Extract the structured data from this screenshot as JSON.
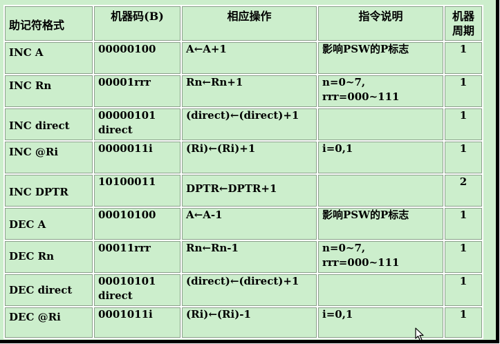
{
  "table": {
    "headers": [
      "助记符格式",
      "机器码(B)",
      "相应操作",
      "指令说明",
      "机器\n周期"
    ],
    "rows": [
      {
        "fmt": "INC A",
        "code": "00000100",
        "op": "A←A+1",
        "desc": "影响PSW的P标志",
        "cycles": "1"
      },
      {
        "fmt": "INC Rn",
        "code": "00001rrr",
        "op": "Rn←Rn+1",
        "desc": "n=0~7,\nrrr=000~111",
        "cycles": "1"
      },
      {
        "fmt": "INC direct",
        "code": "00000101\ndirect",
        "op": "(direct)←(direct)+1",
        "desc": "",
        "cycles": "1"
      },
      {
        "fmt": "INC @Ri",
        "code": "0000011i",
        "op": "(Ri)←(Ri)+1",
        "desc": "i=0,1",
        "cycles": "1"
      },
      {
        "fmt": "INC DPTR",
        "code": "10100011",
        "op": "DPTR←DPTR+1",
        "desc": "",
        "cycles": "2"
      },
      {
        "fmt": "DEC A",
        "code": "00010100",
        "op": "A←A-1",
        "desc": "影响PSW的P标志",
        "cycles": "1"
      },
      {
        "fmt": "DEC Rn",
        "code": "00011rrr",
        "op": "Rn←Rn-1",
        "desc": "n=0~7,\nrrr=000~111",
        "cycles": "1"
      },
      {
        "fmt": "DEC direct",
        "code": "00010101\ndirect",
        "op": "(direct)←(direct)+1",
        "desc": "",
        "cycles": "1"
      },
      {
        "fmt": "DEC @Ri",
        "code": "0001011i",
        "op": "(Ri)←(Ri)-1",
        "desc": "i=0,1",
        "cycles": "1"
      }
    ]
  },
  "colors": {
    "background": "#cceecc",
    "grid_light": "#ffffff",
    "grid_dark": "#8a9f8a",
    "text": "#000000"
  },
  "cursor_icon": "mouse-pointer-icon"
}
